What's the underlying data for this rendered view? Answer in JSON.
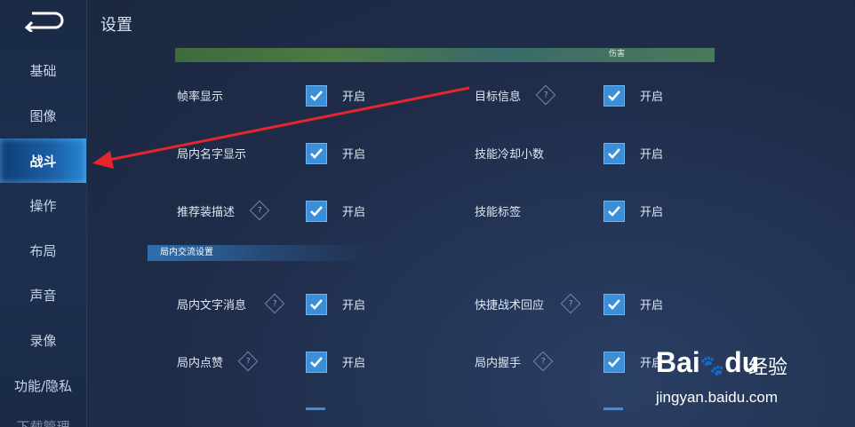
{
  "header": {
    "title": "设置"
  },
  "sidebar": {
    "items": [
      {
        "label": "基础"
      },
      {
        "label": "图像"
      },
      {
        "label": "战斗"
      },
      {
        "label": "操作"
      },
      {
        "label": "布局"
      },
      {
        "label": "声音"
      },
      {
        "label": "录像"
      },
      {
        "label": "功能/隐私"
      },
      {
        "label": "下载管理"
      }
    ],
    "active": "战斗"
  },
  "banner": {
    "tag": "伤害"
  },
  "settings": {
    "rows": [
      {
        "label": "帧率显示",
        "state": "开启",
        "checked": true,
        "help": false
      },
      {
        "label": "目标信息",
        "state": "开启",
        "checked": true,
        "help": true
      },
      {
        "label": "局内名字显示",
        "state": "开启",
        "checked": true,
        "help": false
      },
      {
        "label": "技能冷却小数",
        "state": "开启",
        "checked": true,
        "help": false
      },
      {
        "label": "推荐装描述",
        "state": "开启",
        "checked": true,
        "help": true
      },
      {
        "label": "技能标签",
        "state": "开启",
        "checked": true,
        "help": false
      }
    ]
  },
  "chat_section": {
    "title": "局内交流设置",
    "rows": [
      {
        "label": "局内文字消息",
        "state": "开启",
        "checked": true,
        "help": true
      },
      {
        "label": "快捷战术回应",
        "state": "开启",
        "checked": true,
        "help": true
      },
      {
        "label": "局内点赞",
        "state": "开启",
        "checked": true,
        "help": true
      },
      {
        "label": "局内握手",
        "state": "开启",
        "checked": true,
        "help": true
      }
    ]
  },
  "help_glyph": "?",
  "watermark": {
    "logo": "Bai",
    "logo2": "du",
    "brand": "经验",
    "url": "jingyan.baidu.com"
  },
  "colors": {
    "accent": "#3b8fd9",
    "active_tab": "#1a5fa6",
    "arrow": "#e8252a"
  }
}
